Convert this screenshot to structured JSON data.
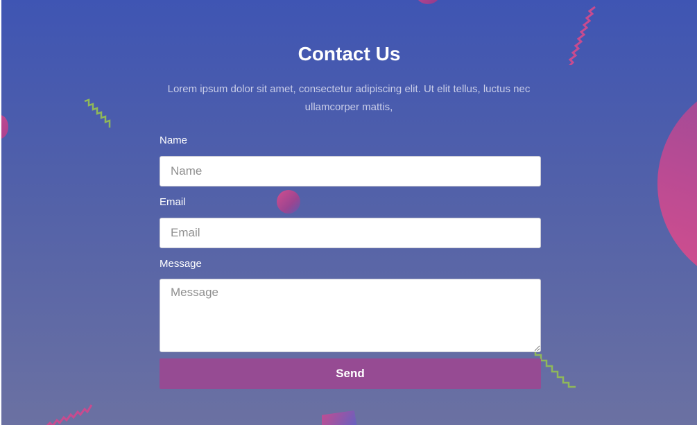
{
  "colors": {
    "background_top": "#3f55b3",
    "background_bottom": "#6b71a2",
    "button": "#964b93",
    "accent_pink": "#c84b8f",
    "accent_green": "#8fb85a"
  },
  "header": {
    "title": "Contact Us",
    "subtitle": "Lorem ipsum dolor sit amet, consectetur adipiscing elit. Ut elit tellus, luctus nec ullamcorper mattis,"
  },
  "form": {
    "name": {
      "label": "Name",
      "placeholder": "Name",
      "value": ""
    },
    "email": {
      "label": "Email",
      "placeholder": "Email",
      "value": ""
    },
    "message": {
      "label": "Message",
      "placeholder": "Message",
      "value": ""
    },
    "submit_label": "Send"
  },
  "decorations": [
    "pink-circle",
    "pink-zigzag",
    "green-zigzag",
    "pink-triangle"
  ]
}
